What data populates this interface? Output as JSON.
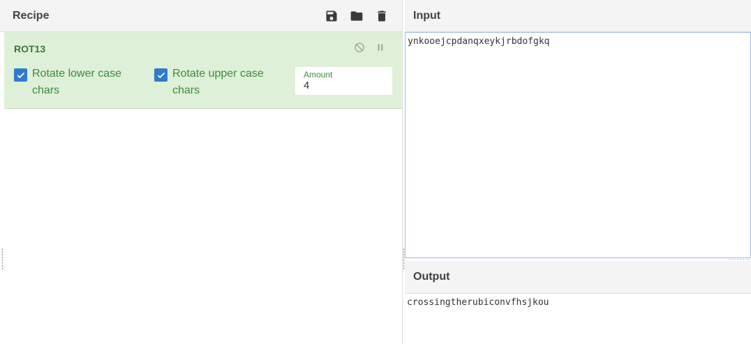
{
  "recipe": {
    "title": "Recipe",
    "icons": [
      "save-icon",
      "folder-icon",
      "trash-icon"
    ],
    "operation": {
      "name": "ROT13",
      "controls": [
        "disable-icon",
        "pause-icon"
      ],
      "options": {
        "rotate_lower_label": "Rotate lower case chars",
        "rotate_lower_checked": true,
        "rotate_upper_label": "Rotate upper case chars",
        "rotate_upper_checked": true,
        "amount_label": "Amount",
        "amount_value": "4"
      },
      "background_color": "#dff0d8",
      "accent_color": "#3c763d"
    }
  },
  "input": {
    "title": "Input",
    "value": "ynkooejcpdanqxeykjrbdofgkq"
  },
  "output": {
    "title": "Output",
    "value": "crossingtherubiconvfhsjkou"
  },
  "colors": {
    "checkbox": "#2e7bcf",
    "header_bg": "#f4f4f4",
    "input_border": "#9dbde6"
  }
}
